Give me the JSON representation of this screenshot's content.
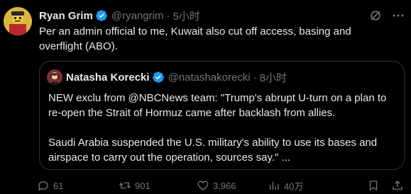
{
  "author": {
    "name": "Ryan Grim",
    "handle": "@ryangrim",
    "separator": "·",
    "time": "5小时"
  },
  "tweet_text_line1": "Per an admin official to me, Kuwait also cut off access, basing and",
  "tweet_text_line2": "overflight (ABO).",
  "quote": {
    "name": "Natasha Korecki",
    "handle": "@natashakorecki",
    "separator": "·",
    "time": "8小时",
    "para1_line1": "NEW exclu from @NBCNews team:  \"Trump's abrupt U-turn on a plan to",
    "para1_line2": "re-open the Strait of Hormuz came after backlash from allies.",
    "para2_line1": "Saudi Arabia suspended the U.S. military's ability to use its bases and",
    "para2_line2": "airspace to carry out the operation, sources say.\" ..."
  },
  "actions": {
    "replies": "61",
    "reposts": "901",
    "likes": "3,966",
    "views": "40万"
  },
  "colors": {
    "background": "#000000",
    "text": "#e7e9ea",
    "muted": "#71767b",
    "verified": "#1d9bf0",
    "border": "#2f3336"
  },
  "icons": [
    "verified-badge-icon",
    "grok-icon",
    "more-icon",
    "reply-icon",
    "repost-icon",
    "like-icon",
    "views-icon",
    "bookmark-icon",
    "share-icon"
  ]
}
